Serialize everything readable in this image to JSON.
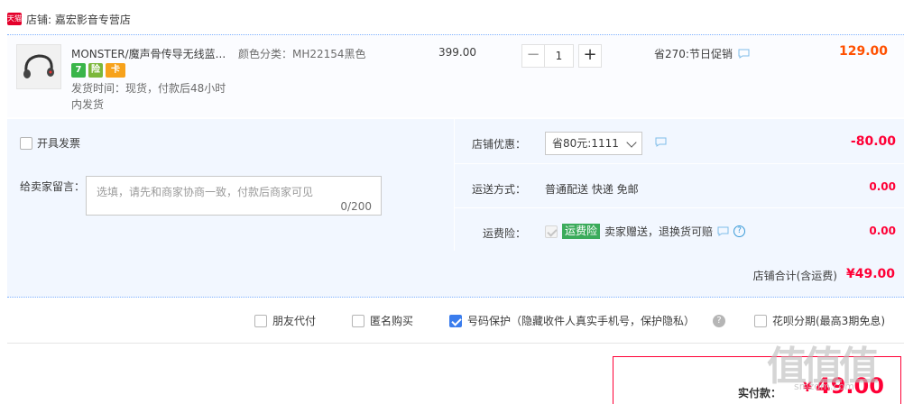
{
  "shop": {
    "badge": "天猫",
    "name": "店铺: 嘉宏影音专营店"
  },
  "item": {
    "title": "MONSTER/魔声骨传导无线蓝...",
    "badges": [
      "7",
      "险",
      "卡"
    ],
    "ship_time": "发货时间：现货，付款后48小时内发货",
    "sku": "颜色分类：MH22154黑色",
    "unit_price": "399.00",
    "qty": {
      "minus": "−",
      "value": "1",
      "plus": "+"
    },
    "promo": "省270:节日促销",
    "total": "129.00"
  },
  "options": {
    "invoice_label": "开具发票",
    "message_label": "给卖家留言：",
    "message_placeholder": "选填，请先和商家协商一致，付款后商家可见",
    "message_count": "0/200"
  },
  "summary": {
    "coupon_label": "店铺优惠：",
    "coupon_value": "省80元:1111",
    "coupon_amount": "-80.00",
    "shipping_label": "运送方式：",
    "shipping_value": "普通配送 快递 免邮",
    "shipping_amount": "0.00",
    "insurance_label": "运费险：",
    "insurance_tag": "运费险",
    "insurance_text": "卖家赠送，退换货可赔",
    "insurance_amount": "0.00",
    "shop_total_label": "店铺合计(含运费)",
    "shop_total_value": "¥49.00"
  },
  "checkout_options": [
    {
      "label": "朋友代付",
      "checked": false
    },
    {
      "label": "匿名购买",
      "checked": false
    },
    {
      "label": "号码保护（隐藏收件人真实手机号，保护隐私）",
      "checked": true
    },
    {
      "label": "花呗分期(最高3期免息)",
      "checked": false
    }
  ],
  "payment": {
    "label": "实付款：",
    "currency": "¥",
    "value": "49.00"
  },
  "watermark": {
    "mark": "值值值",
    "site": "smzdm.com"
  },
  "colors": {
    "accent_red": "#ff0036",
    "orange": "#ff5000",
    "blue_check": "#3b7ded",
    "panel_bg": "#f2f7ff",
    "insurance_green": "#3bab5b"
  }
}
